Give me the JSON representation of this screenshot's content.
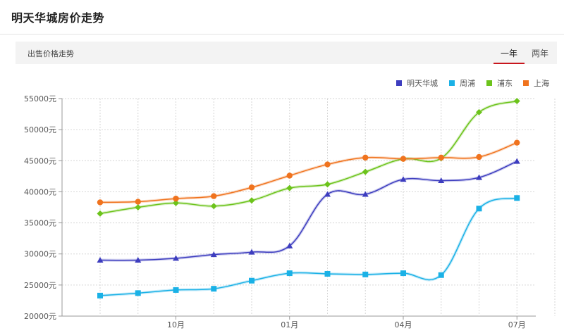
{
  "header": {
    "title": "明天华城房价走势"
  },
  "toolbar": {
    "label": "出售价格走势",
    "tabs": [
      {
        "label": "一年",
        "active": true
      },
      {
        "label": "两年",
        "active": false
      }
    ],
    "accent_color": "#c8161d"
  },
  "chart_data": {
    "type": "line",
    "x": [
      "2016-08",
      "2016-09",
      "2016-10",
      "2016-11",
      "2016-12",
      "2017-01",
      "2017-02",
      "2017-03",
      "2017-04",
      "2017-05",
      "2017-06",
      "2017-07",
      "2017-08"
    ],
    "x_tick_labels": [
      {
        "x": "2016-10",
        "label": "10月"
      },
      {
        "x": "2017-01",
        "label": "01月"
      },
      {
        "x": "2017-04",
        "label": "04月"
      },
      {
        "x": "2017-07",
        "label": "07月"
      }
    ],
    "ylim": [
      20000,
      55000
    ],
    "y_ticks": [
      20000,
      25000,
      30000,
      35000,
      40000,
      45000,
      50000,
      55000
    ],
    "y_tick_labels": [
      "20000元",
      "25000元",
      "30000元",
      "35000元",
      "40000元",
      "45000元",
      "50000元",
      "55000元"
    ],
    "grid": true,
    "legend_position": "top-right",
    "series": [
      {
        "name": "明天华城",
        "color": "#3d3dbf",
        "marker": "triangle",
        "values": [
          29000,
          29000,
          29300,
          29900,
          30300,
          31300,
          39600,
          39600,
          42000,
          41800,
          42300,
          44900
        ]
      },
      {
        "name": "周浦",
        "color": "#1ab1e6",
        "marker": "square",
        "values": [
          23300,
          23700,
          24200,
          24400,
          25700,
          26900,
          26800,
          26700,
          26900,
          26600,
          37300,
          39000
        ]
      },
      {
        "name": "浦东",
        "color": "#6cc31b",
        "marker": "diamond",
        "values": [
          36500,
          37500,
          38200,
          37700,
          38600,
          40600,
          41200,
          43200,
          45300,
          45400,
          52800,
          54600
        ]
      },
      {
        "name": "上海",
        "color": "#f0731e",
        "marker": "circle",
        "values": [
          38300,
          38400,
          38900,
          39300,
          40700,
          42600,
          44400,
          45500,
          45300,
          45500,
          45600,
          47900
        ]
      }
    ]
  }
}
